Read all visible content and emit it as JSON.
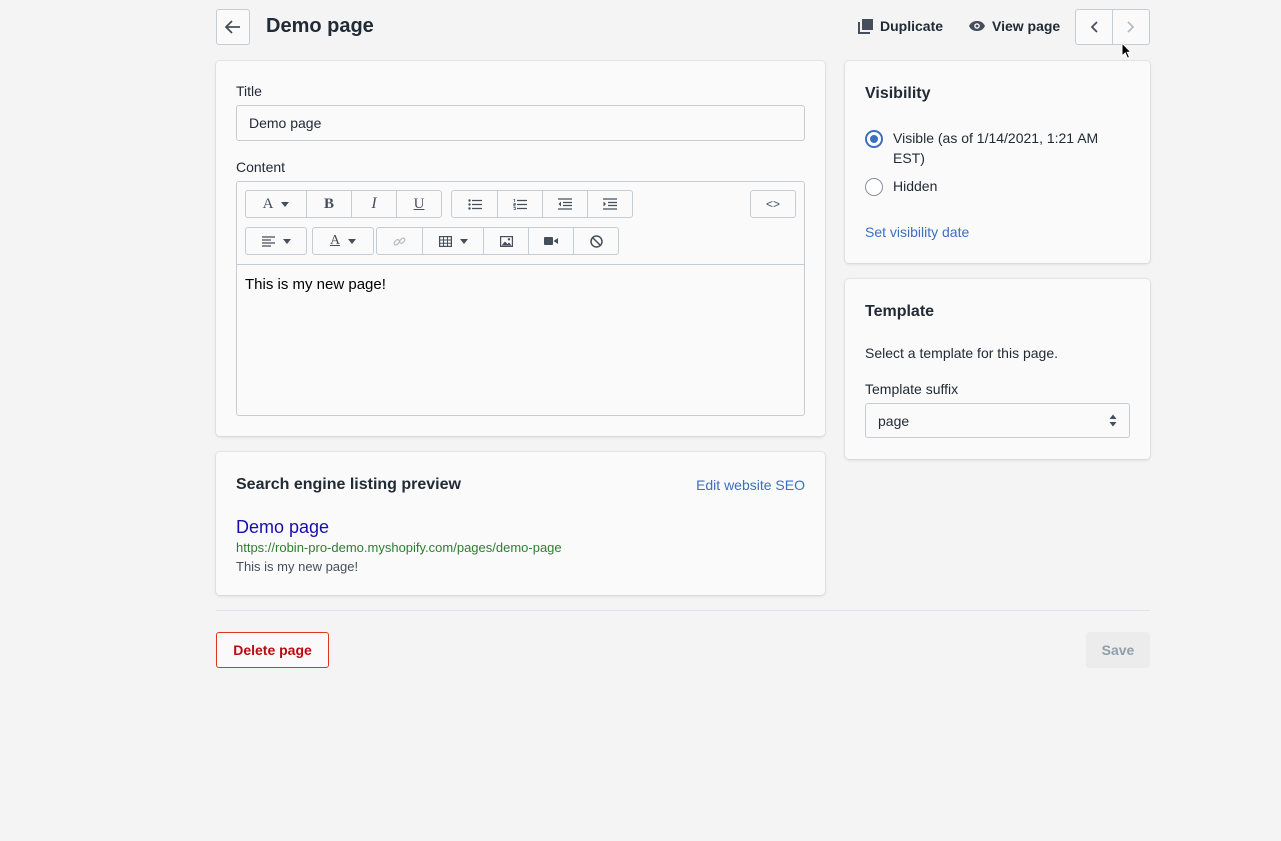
{
  "header": {
    "title": "Demo page",
    "duplicate_label": "Duplicate",
    "view_page_label": "View page"
  },
  "content_card": {
    "title_label": "Title",
    "title_value": "Demo page",
    "content_label": "Content",
    "editor_text": "This is my new page!",
    "html_toggle": "<>"
  },
  "seo_card": {
    "heading": "Search engine listing preview",
    "edit_link": "Edit website SEO",
    "preview_title": "Demo page",
    "preview_url": "https://robin-pro-demo.myshopify.com/pages/demo-page",
    "preview_description": "This is my new page!"
  },
  "visibility_card": {
    "heading": "Visibility",
    "visible_option_line1": "Visible (as of 1/14/2021, 1:21 AM",
    "visible_option_line2": "EST)",
    "hidden_option": "Hidden",
    "selected": "visible",
    "set_date_link": "Set visibility date"
  },
  "template_card": {
    "heading": "Template",
    "description": "Select a template for this page.",
    "suffix_label": "Template suffix",
    "suffix_value": "page"
  },
  "footer": {
    "delete_label": "Delete page",
    "save_label": "Save"
  },
  "colors": {
    "accent": "#3b6fbf",
    "seo_title": "#1a0dab",
    "seo_url": "#2e7d32",
    "danger": "#bf0711"
  }
}
